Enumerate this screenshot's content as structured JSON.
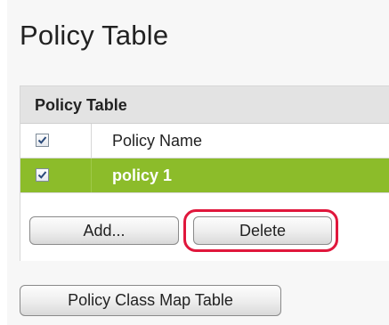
{
  "page": {
    "title": "Policy Table"
  },
  "policy_table": {
    "caption": "Policy Table",
    "header": {
      "select_all_checked": true,
      "column_policy_name": "Policy Name"
    },
    "rows": [
      {
        "checked": true,
        "policy_name": "policy 1",
        "selected": true
      }
    ],
    "buttons": {
      "add_label": "Add...",
      "delete_label": "Delete"
    }
  },
  "footer_buttons": {
    "class_map_label": "Policy Class Map Table"
  },
  "colors": {
    "selected_row": "#8cbc2a",
    "highlight_ring": "#e0173c",
    "caption_bg": "#e3e3e3"
  }
}
